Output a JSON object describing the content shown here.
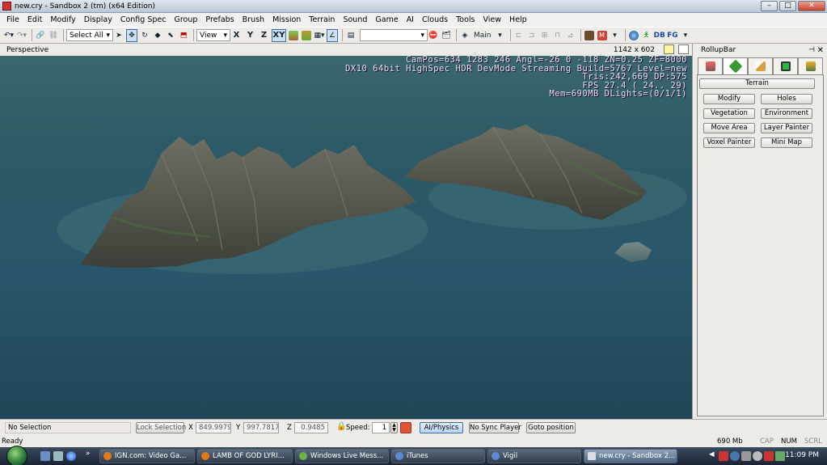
{
  "window": {
    "title": "new.cry - Sandbox 2 (tm) (x64 Edition)",
    "buttons": {
      "minimize": "–",
      "maximize": "□",
      "close": "✕"
    }
  },
  "menu": [
    "File",
    "Edit",
    "Modify",
    "Display",
    "Config Spec",
    "Group",
    "Prefabs",
    "Brush",
    "Mission",
    "Terrain",
    "Sound",
    "Game",
    "AI",
    "Clouds",
    "Tools",
    "View",
    "Help"
  ],
  "toolbar": {
    "select_all": "Select All",
    "coord_system": "View",
    "axes": [
      "X",
      "Y",
      "Z",
      "XY"
    ],
    "layer": "Main",
    "db_label": "DB",
    "fg_label": "FG"
  },
  "viewport": {
    "label": "Perspective",
    "resolution": "1142 x 602",
    "hud": [
      "CamPos=634 1283 246 Angl=-26  0 -118 ZN=0.25 ZF=8000",
      "DX10 64bit HighSpec HDR DevMode Streaming Build=5767 Level=new",
      "Tris:242,669  DP:575",
      "FPS  27.4 ( 24.. 29)",
      "Mem=690MB DLights=(0/1/1)"
    ]
  },
  "rollup": {
    "title": "RollupBar",
    "pin": "⊣",
    "close": "✕",
    "tabs": [
      "objects-tab",
      "terrain-tab",
      "modeling-tab",
      "display-tab",
      "layers-tab"
    ],
    "panel_title": "Terrain",
    "buttons": [
      "Modify",
      "Holes",
      "Vegetation",
      "Environment",
      "Move Area",
      "Layer Painter",
      "Voxel Painter",
      "Mini Map"
    ]
  },
  "statusbar": {
    "selection": "No Selection",
    "lock_selection": "Lock Selection",
    "x_label": "X",
    "x_value": "849.9979",
    "y_label": "Y",
    "y_value": "997.7817",
    "z_label": "Z",
    "z_value": "0.9485",
    "speed_label": "Speed:",
    "speed_value": "1",
    "ai_physics": "AI/Physics",
    "sync_player": "No Sync Player",
    "goto_position": "Goto position"
  },
  "readybar": {
    "status": "Ready",
    "memory": "690 Mb",
    "cap": "CAP",
    "num": "NUM",
    "scrl": "SCRL"
  },
  "taskbar": {
    "tasks": [
      {
        "label": "IGN.com: Video Ga...",
        "color": "#e07b1a"
      },
      {
        "label": "LAMB OF GOD LYRI...",
        "color": "#e07b1a"
      },
      {
        "label": "Windows Live Mess...",
        "color": "#6ab04c"
      },
      {
        "label": "iTunes",
        "color": "#5b8bd6"
      },
      {
        "label": "Vigil",
        "color": "#5b8bd6"
      },
      {
        "label": "new.cry - Sandbox 2...",
        "color": "#dddddd"
      }
    ],
    "clock": "11:09 PM"
  }
}
